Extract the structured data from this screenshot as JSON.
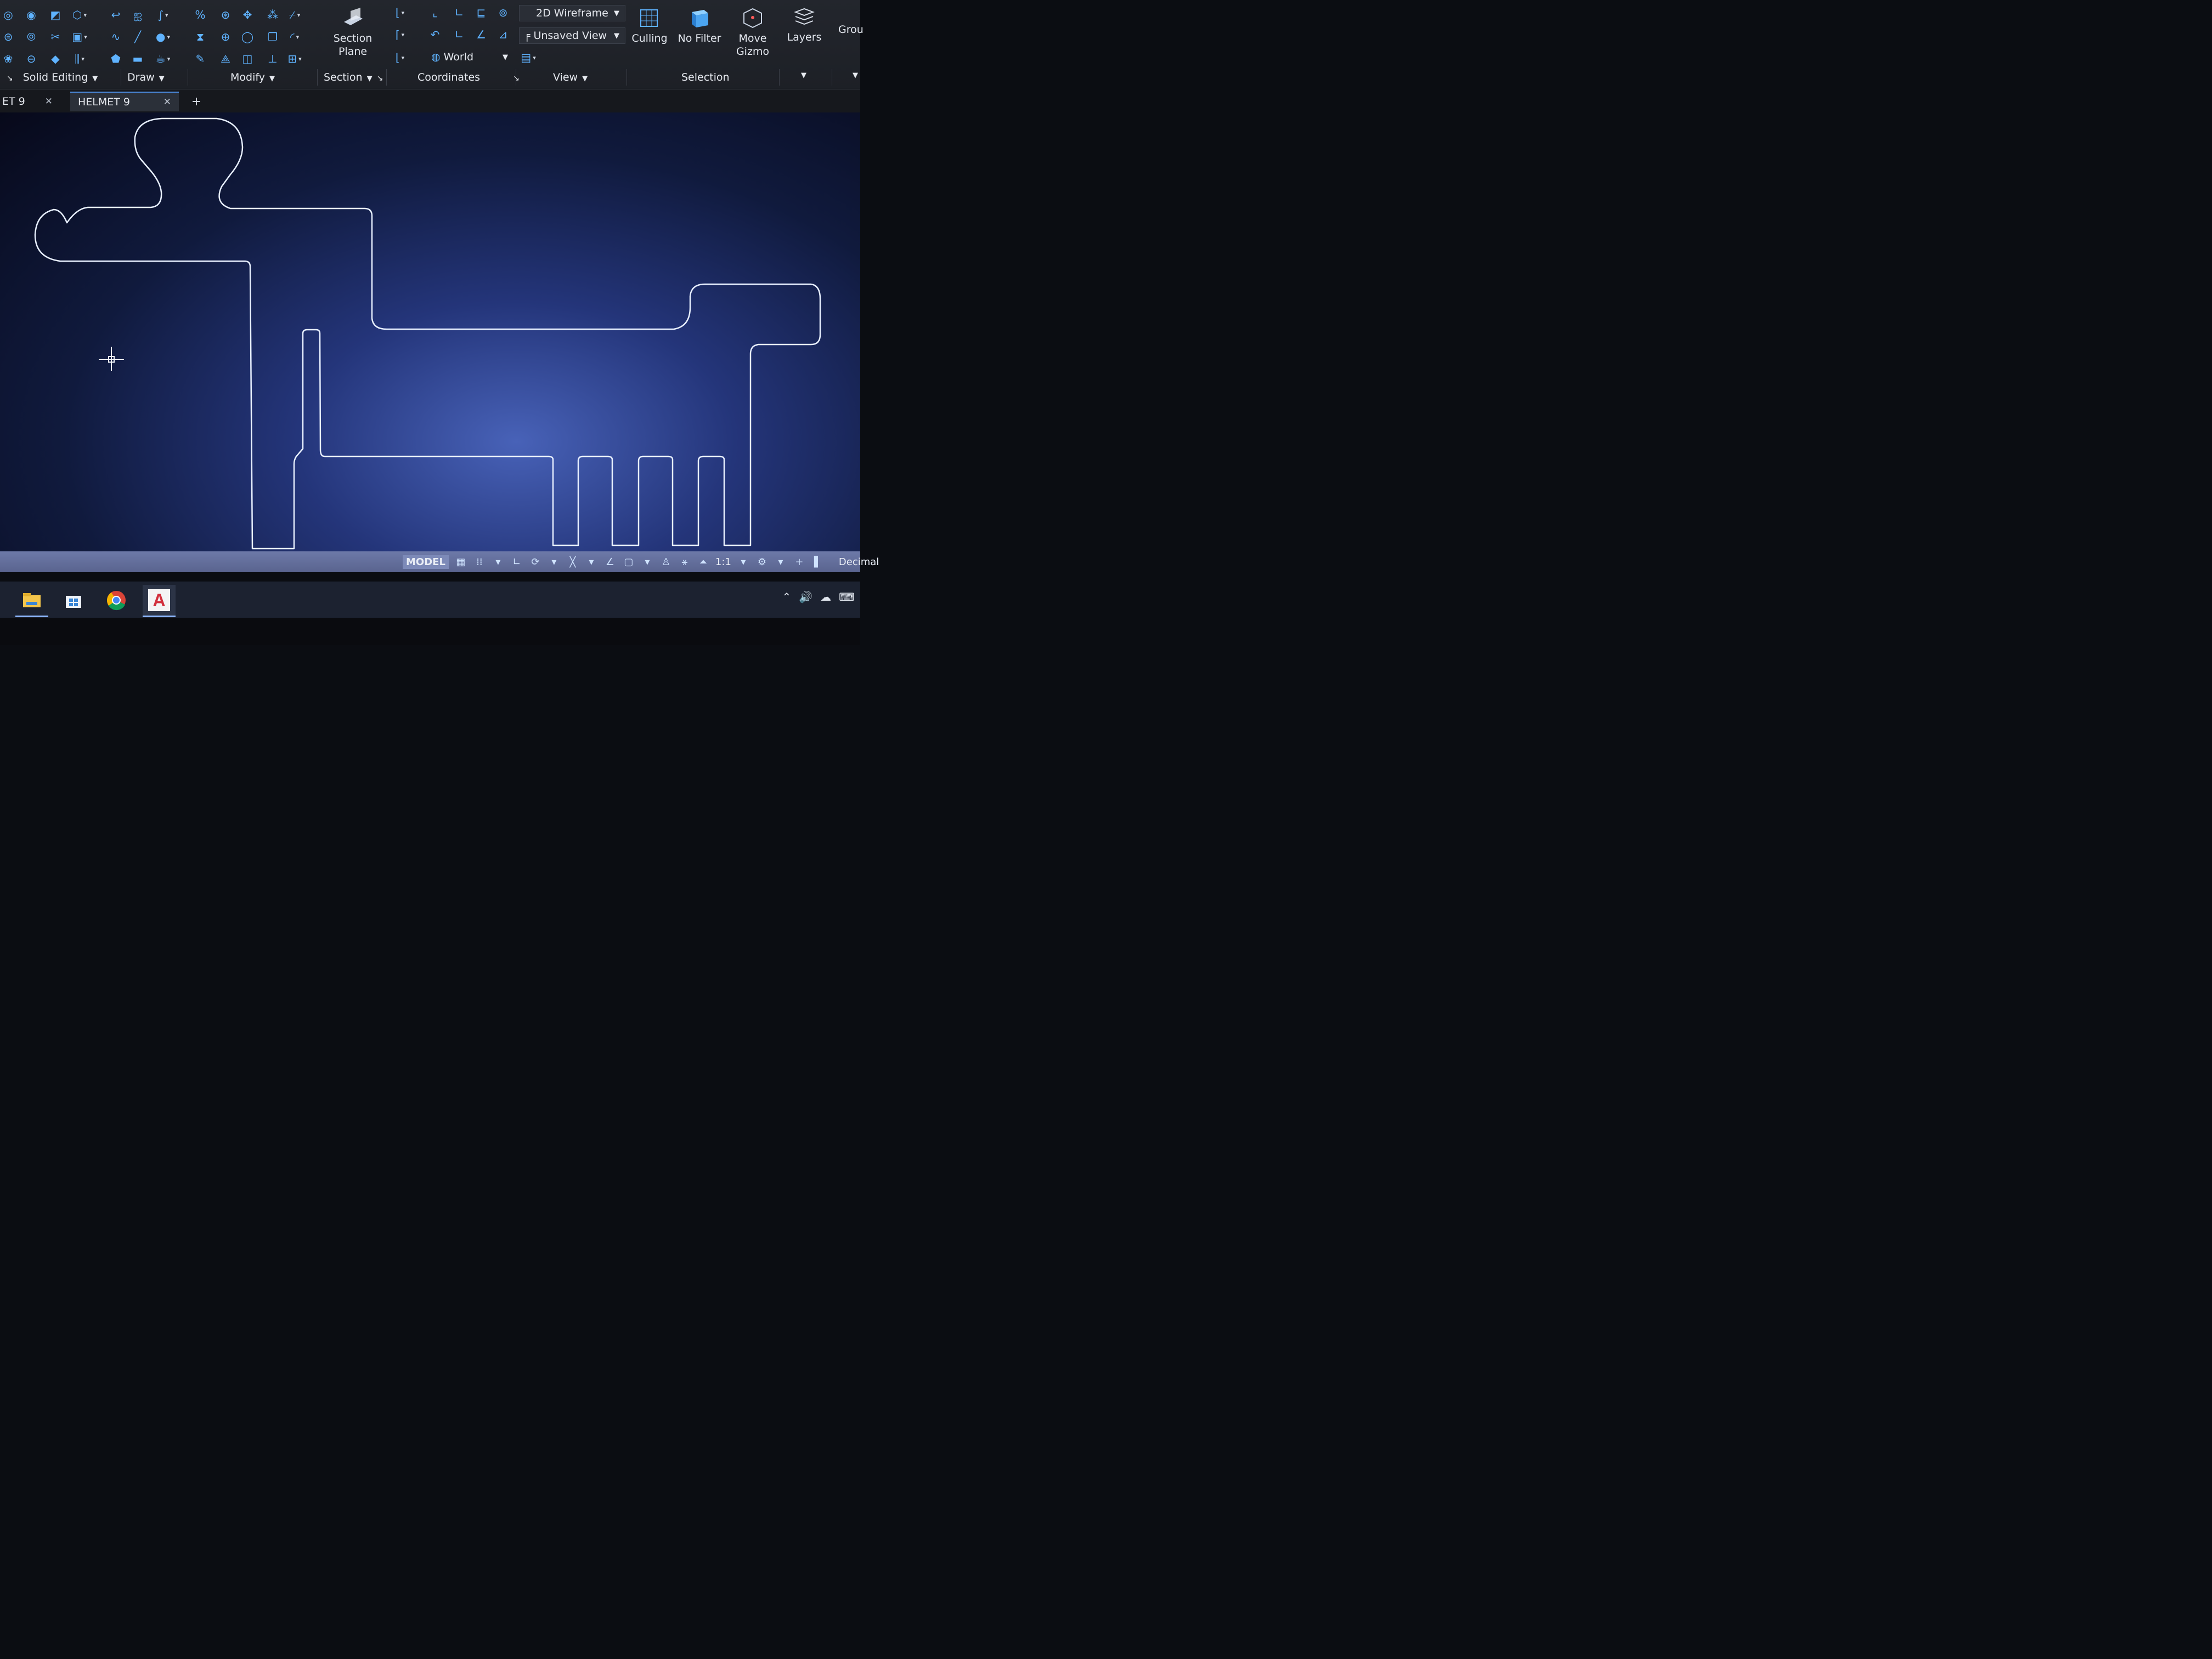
{
  "ribbon": {
    "panels": {
      "solid_editing": "Solid Editing",
      "draw": "Draw",
      "modify": "Modify",
      "section": "Section",
      "coordinates": "Coordinates",
      "view": "View",
      "selection": "Selection"
    },
    "section_plane": "Section\nPlane",
    "visual_style": "2D Wireframe",
    "saved_view": "Unsaved View",
    "ucs": "World",
    "culling": "Culling",
    "no_filter": "No Filter",
    "move_gizmo": "Move\nGizmo",
    "layers": "Layers",
    "groups_partial": "Grou"
  },
  "tabs": [
    {
      "label": "ET 9",
      "state": "partial"
    },
    {
      "label": "HELMET 9",
      "state": "active"
    }
  ],
  "new_tab_symbol": "+",
  "status": {
    "model": "MODEL",
    "scale": "1:1",
    "units": "Decimal"
  },
  "taskbar": {
    "apps": [
      "file-explorer-icon",
      "store-icon",
      "chrome-icon",
      "autocad-icon"
    ],
    "autocad_letter": "A"
  },
  "colors": {
    "accent": "#4a87d8",
    "ribbon_icon": "#5fb3ff",
    "outline": "#e8f0ff"
  }
}
